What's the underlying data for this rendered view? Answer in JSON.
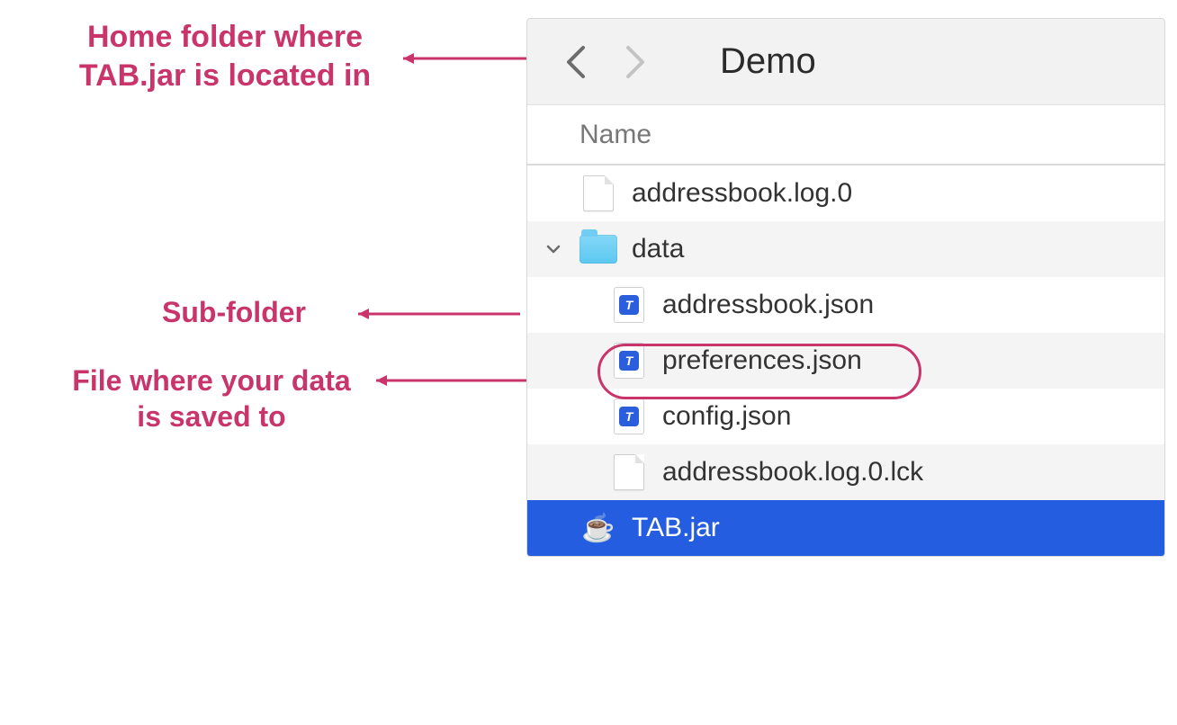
{
  "annotations": {
    "home": "Home folder where TAB.jar is located in",
    "sub": "Sub-folder",
    "data": "File where your data is saved to"
  },
  "finder": {
    "title": "Demo",
    "column_header": "Name",
    "rows": [
      {
        "name": "addressbook.log.0"
      },
      {
        "name": "data"
      },
      {
        "name": "addressbook.json"
      },
      {
        "name": "preferences.json"
      },
      {
        "name": "config.json"
      },
      {
        "name": "addressbook.log.0.lck"
      },
      {
        "name": "TAB.jar"
      }
    ]
  },
  "icons": {
    "json_badge": "T"
  },
  "colors": {
    "annotation": "#c9356b",
    "selection": "#245de0"
  }
}
